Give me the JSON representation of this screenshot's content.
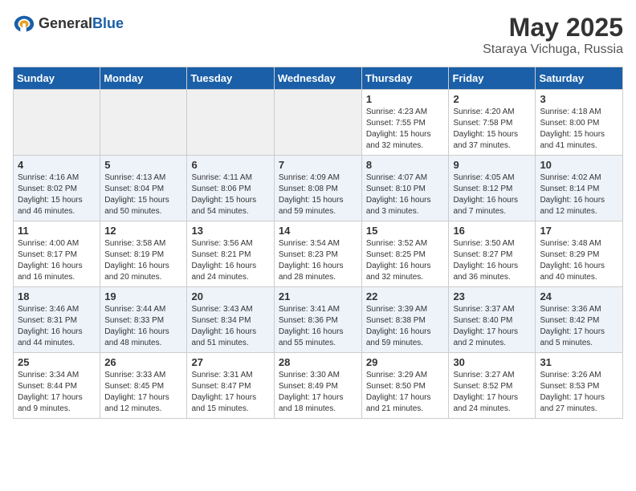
{
  "header": {
    "logo_line1": "General",
    "logo_line2": "Blue",
    "title": "May 2025",
    "location": "Staraya Vichuga, Russia"
  },
  "weekdays": [
    "Sunday",
    "Monday",
    "Tuesday",
    "Wednesday",
    "Thursday",
    "Friday",
    "Saturday"
  ],
  "weeks": [
    [
      {
        "day": "",
        "info": ""
      },
      {
        "day": "",
        "info": ""
      },
      {
        "day": "",
        "info": ""
      },
      {
        "day": "",
        "info": ""
      },
      {
        "day": "1",
        "info": "Sunrise: 4:23 AM\nSunset: 7:55 PM\nDaylight: 15 hours\nand 32 minutes."
      },
      {
        "day": "2",
        "info": "Sunrise: 4:20 AM\nSunset: 7:58 PM\nDaylight: 15 hours\nand 37 minutes."
      },
      {
        "day": "3",
        "info": "Sunrise: 4:18 AM\nSunset: 8:00 PM\nDaylight: 15 hours\nand 41 minutes."
      }
    ],
    [
      {
        "day": "4",
        "info": "Sunrise: 4:16 AM\nSunset: 8:02 PM\nDaylight: 15 hours\nand 46 minutes."
      },
      {
        "day": "5",
        "info": "Sunrise: 4:13 AM\nSunset: 8:04 PM\nDaylight: 15 hours\nand 50 minutes."
      },
      {
        "day": "6",
        "info": "Sunrise: 4:11 AM\nSunset: 8:06 PM\nDaylight: 15 hours\nand 54 minutes."
      },
      {
        "day": "7",
        "info": "Sunrise: 4:09 AM\nSunset: 8:08 PM\nDaylight: 15 hours\nand 59 minutes."
      },
      {
        "day": "8",
        "info": "Sunrise: 4:07 AM\nSunset: 8:10 PM\nDaylight: 16 hours\nand 3 minutes."
      },
      {
        "day": "9",
        "info": "Sunrise: 4:05 AM\nSunset: 8:12 PM\nDaylight: 16 hours\nand 7 minutes."
      },
      {
        "day": "10",
        "info": "Sunrise: 4:02 AM\nSunset: 8:14 PM\nDaylight: 16 hours\nand 12 minutes."
      }
    ],
    [
      {
        "day": "11",
        "info": "Sunrise: 4:00 AM\nSunset: 8:17 PM\nDaylight: 16 hours\nand 16 minutes."
      },
      {
        "day": "12",
        "info": "Sunrise: 3:58 AM\nSunset: 8:19 PM\nDaylight: 16 hours\nand 20 minutes."
      },
      {
        "day": "13",
        "info": "Sunrise: 3:56 AM\nSunset: 8:21 PM\nDaylight: 16 hours\nand 24 minutes."
      },
      {
        "day": "14",
        "info": "Sunrise: 3:54 AM\nSunset: 8:23 PM\nDaylight: 16 hours\nand 28 minutes."
      },
      {
        "day": "15",
        "info": "Sunrise: 3:52 AM\nSunset: 8:25 PM\nDaylight: 16 hours\nand 32 minutes."
      },
      {
        "day": "16",
        "info": "Sunrise: 3:50 AM\nSunset: 8:27 PM\nDaylight: 16 hours\nand 36 minutes."
      },
      {
        "day": "17",
        "info": "Sunrise: 3:48 AM\nSunset: 8:29 PM\nDaylight: 16 hours\nand 40 minutes."
      }
    ],
    [
      {
        "day": "18",
        "info": "Sunrise: 3:46 AM\nSunset: 8:31 PM\nDaylight: 16 hours\nand 44 minutes."
      },
      {
        "day": "19",
        "info": "Sunrise: 3:44 AM\nSunset: 8:33 PM\nDaylight: 16 hours\nand 48 minutes."
      },
      {
        "day": "20",
        "info": "Sunrise: 3:43 AM\nSunset: 8:34 PM\nDaylight: 16 hours\nand 51 minutes."
      },
      {
        "day": "21",
        "info": "Sunrise: 3:41 AM\nSunset: 8:36 PM\nDaylight: 16 hours\nand 55 minutes."
      },
      {
        "day": "22",
        "info": "Sunrise: 3:39 AM\nSunset: 8:38 PM\nDaylight: 16 hours\nand 59 minutes."
      },
      {
        "day": "23",
        "info": "Sunrise: 3:37 AM\nSunset: 8:40 PM\nDaylight: 17 hours\nand 2 minutes."
      },
      {
        "day": "24",
        "info": "Sunrise: 3:36 AM\nSunset: 8:42 PM\nDaylight: 17 hours\nand 5 minutes."
      }
    ],
    [
      {
        "day": "25",
        "info": "Sunrise: 3:34 AM\nSunset: 8:44 PM\nDaylight: 17 hours\nand 9 minutes."
      },
      {
        "day": "26",
        "info": "Sunrise: 3:33 AM\nSunset: 8:45 PM\nDaylight: 17 hours\nand 12 minutes."
      },
      {
        "day": "27",
        "info": "Sunrise: 3:31 AM\nSunset: 8:47 PM\nDaylight: 17 hours\nand 15 minutes."
      },
      {
        "day": "28",
        "info": "Sunrise: 3:30 AM\nSunset: 8:49 PM\nDaylight: 17 hours\nand 18 minutes."
      },
      {
        "day": "29",
        "info": "Sunrise: 3:29 AM\nSunset: 8:50 PM\nDaylight: 17 hours\nand 21 minutes."
      },
      {
        "day": "30",
        "info": "Sunrise: 3:27 AM\nSunset: 8:52 PM\nDaylight: 17 hours\nand 24 minutes."
      },
      {
        "day": "31",
        "info": "Sunrise: 3:26 AM\nSunset: 8:53 PM\nDaylight: 17 hours\nand 27 minutes."
      }
    ]
  ]
}
